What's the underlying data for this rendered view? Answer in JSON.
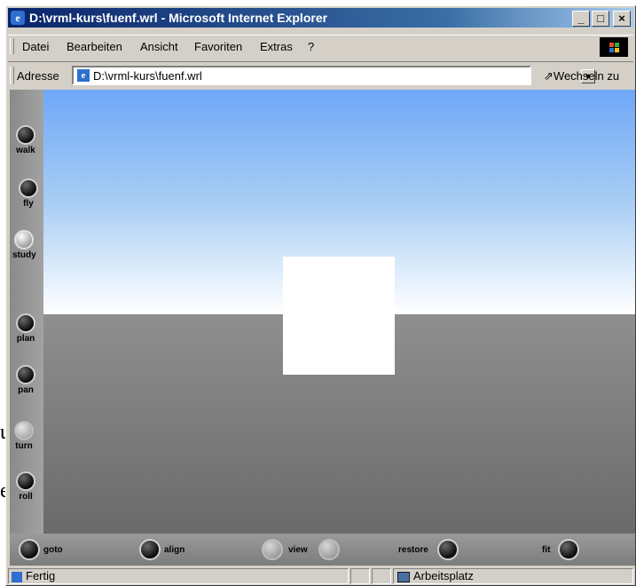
{
  "window": {
    "title": "D:\\vrml-kurs\\fuenf.wrl - Microsoft Internet Explorer",
    "minimize": "_",
    "maximize": "□",
    "close": "×"
  },
  "menu": [
    "Datei",
    "Bearbeiten",
    "Ansicht",
    "Favoriten",
    "Extras",
    "?"
  ],
  "address": {
    "label": "Adresse",
    "value": "D:\\vrml-kurs\\fuenf.wrl",
    "go": "Wechseln zu"
  },
  "nav_tools": [
    "walk",
    "fly",
    "study",
    "plan",
    "pan",
    "turn",
    "roll"
  ],
  "controls": {
    "goto": "goto",
    "align": "align",
    "view": "view",
    "restore": "restore",
    "fit": "fit"
  },
  "status": {
    "text": "Fertig",
    "zone": "Arbeitsplatz"
  },
  "background_glyphs": [
    "u",
    "e"
  ],
  "colors": {
    "titlebar": "#0a246a",
    "sky_top": "#6fa8f8",
    "ground": "#7a7a7a"
  }
}
